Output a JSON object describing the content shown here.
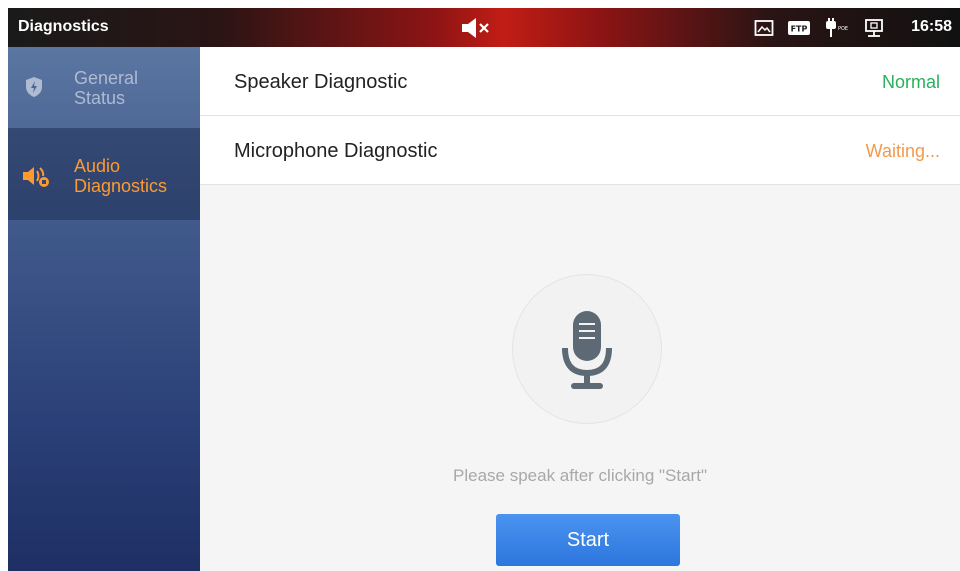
{
  "statusbar": {
    "title": "Diagnostics",
    "time": "16:58",
    "icons": [
      "mute-icon",
      "screenshot-icon",
      "ftp-icon",
      "poe-power-icon",
      "network-icon"
    ],
    "ftp_label": "FTP",
    "poe_label": "POE"
  },
  "sidebar": {
    "items": [
      {
        "label": "General Status",
        "icon": "shield-icon",
        "selected": false
      },
      {
        "label": "Audio Diagnostics",
        "icon": "speaker-icon",
        "selected": true
      }
    ]
  },
  "main": {
    "rows": [
      {
        "name": "Speaker Diagnostic",
        "status": "Normal"
      },
      {
        "name": "Microphone Diagnostic",
        "status": "Waiting..."
      }
    ],
    "mic_icon": "microphone-icon",
    "hint": "Please speak after clicking \"Start\"",
    "start_label": "Start"
  },
  "colors": {
    "accent_orange": "#ff9a2e",
    "status_normal": "#29b05c",
    "status_waiting": "#f19a4e",
    "button_blue": "#3a84e6"
  }
}
